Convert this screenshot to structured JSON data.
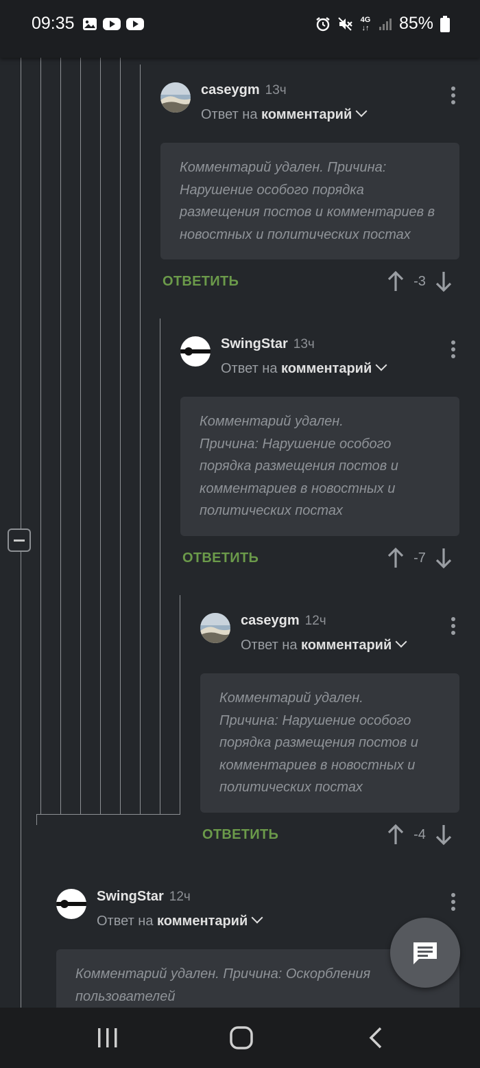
{
  "status_bar": {
    "time": "09:35",
    "battery": "85%",
    "left_icons": [
      "gallery-icon",
      "youtube-icon",
      "youtube-icon"
    ],
    "right_icons": [
      "alarm-icon",
      "mute-icon",
      "4g-icon",
      "signal-icon",
      "battery-icon"
    ],
    "network_label": "4G"
  },
  "comments": [
    {
      "author": "caseygm",
      "time": "13ч",
      "reply_prefix": "Ответ на",
      "reply_target": "комментарий",
      "body": "Комментарий удален. Причина:\nНарушение особого порядка\nразмещения постов и комментариев в\nновостных и политических постах",
      "reply_label": "ОТВЕТИТЬ",
      "score": "-3",
      "avatar": "landscape"
    },
    {
      "author": "SwingStar",
      "time": "13ч",
      "reply_prefix": "Ответ на",
      "reply_target": "комментарий",
      "body": "Комментарий удален.\nПричина: Нарушение особого\nпорядка размещения постов и\nкомментариев в новостных и\nполитических постах",
      "reply_label": "ОТВЕТИТЬ",
      "score": "-7",
      "avatar": "guitar"
    },
    {
      "author": "caseygm",
      "time": "12ч",
      "reply_prefix": "Ответ на",
      "reply_target": "комментарий",
      "body": "Комментарий удален.\nПричина: Нарушение особого\nпорядка размещения постов и\nкомментариев в новостных и\nполитических постах",
      "reply_label": "ОТВЕТИТЬ",
      "score": "-4",
      "avatar": "landscape"
    },
    {
      "author": "SwingStar",
      "time": "12ч",
      "reply_prefix": "Ответ на",
      "reply_target": "комментарий",
      "body": "Комментарий удален. Причина: Оскорбления\nпользователей",
      "avatar": "guitar"
    }
  ],
  "fab": {
    "icon": "chat-icon"
  },
  "nav_bar": {
    "icons": [
      "recent-apps-icon",
      "home-icon",
      "back-icon"
    ]
  },
  "colors": {
    "accent_green": "#6b9a4a",
    "background": "#24272b",
    "card": "#34373c"
  }
}
